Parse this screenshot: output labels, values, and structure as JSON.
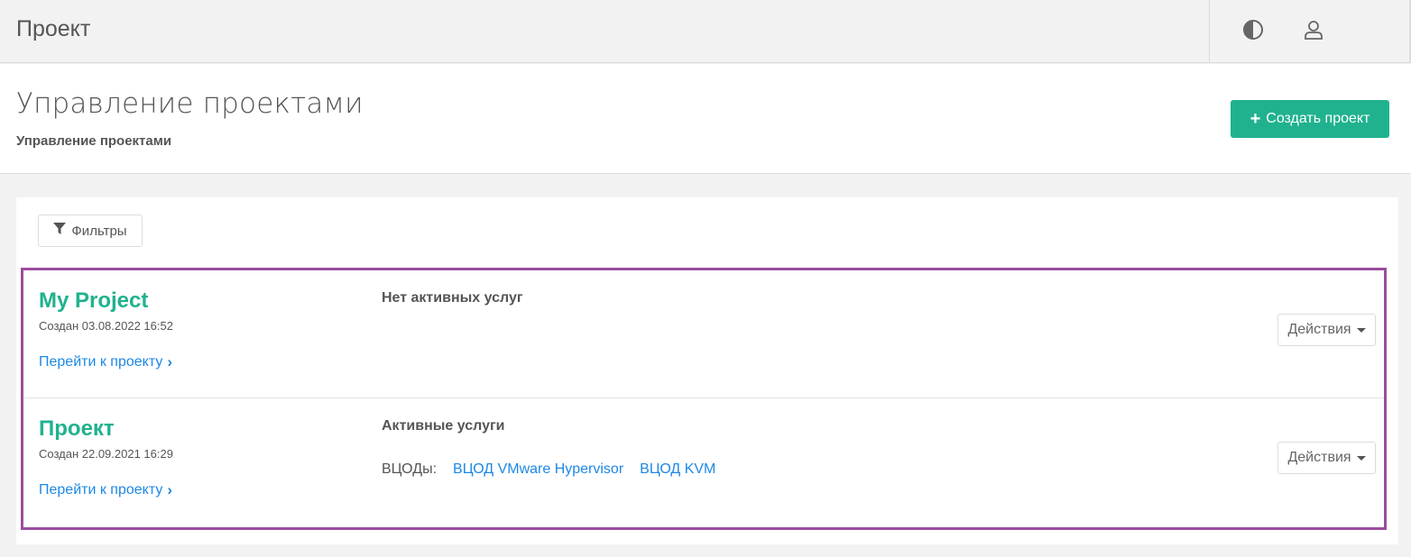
{
  "topbar": {
    "title": "Проект",
    "icons": [
      "contrast-icon",
      "user-icon"
    ]
  },
  "header": {
    "title": "Управление проектами",
    "breadcrumb": "Управление проектами",
    "create_button_label": "Создать проект",
    "create_button_icon": "plus-icon"
  },
  "filters": {
    "label": "Фильтры",
    "icon": "filter-icon"
  },
  "projects": [
    {
      "name": "My Project",
      "created": "Создан 03.08.2022 16:52",
      "link_label": "Перейти к проекту",
      "services_title": "Нет активных услуг",
      "services_prefix": "",
      "services": [],
      "actions_label": "Действия"
    },
    {
      "name": "Проект",
      "created": "Создан 22.09.2021 16:29",
      "link_label": "Перейти к проекту",
      "services_title": "Активные услуги",
      "services_prefix": "ВЦОДы:",
      "services": [
        "ВЦОД VMware Hypervisor",
        "ВЦОД KVM"
      ],
      "actions_label": "Действия"
    }
  ],
  "colors": {
    "accent": "#20b28e",
    "link": "#1e88e5",
    "highlight": "#9b4d9e"
  }
}
